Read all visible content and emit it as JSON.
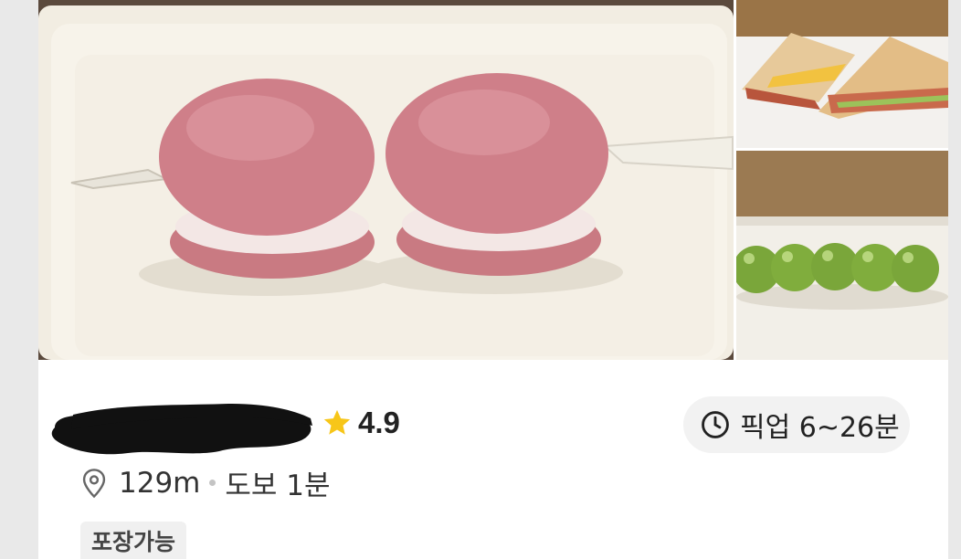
{
  "store": {
    "rating": "4.9",
    "rating_icon": "star-icon",
    "name_redacted": true
  },
  "pickup": {
    "label": "픽업 6~26분",
    "icon": "clock-icon"
  },
  "location": {
    "icon": "map-pin-icon",
    "distance": "129m",
    "walk": "도보 1분"
  },
  "tags": [
    "포장가능"
  ],
  "photos": {
    "main": "macaron-skewer",
    "side_top": "toast-sandwich",
    "side_bottom": "green-grape-skewer"
  },
  "colors": {
    "star": "#f7c619",
    "pill_bg": "#f2f2f2",
    "tag_bg": "#f0f0f0",
    "text": "#222222"
  }
}
